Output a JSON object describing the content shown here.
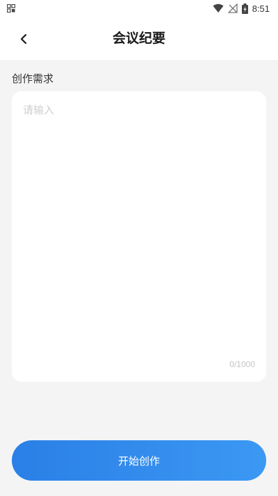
{
  "status_bar": {
    "time": "8:51",
    "icons": [
      "app-grid-icon",
      "wifi-icon",
      "no-signal-icon",
      "battery-charging-icon"
    ]
  },
  "header": {
    "back_icon": "chevron-left-icon",
    "title": "会议纪要"
  },
  "form": {
    "section_label": "创作需求",
    "input": {
      "value": "",
      "placeholder": "请输入"
    },
    "char_count": "0/1000"
  },
  "actions": {
    "start_label": "开始创作"
  },
  "colors": {
    "accent_start": "#2b7fe6",
    "accent_end": "#3b98f3",
    "background": "#f4f4f5",
    "placeholder": "#cfcfd2"
  }
}
